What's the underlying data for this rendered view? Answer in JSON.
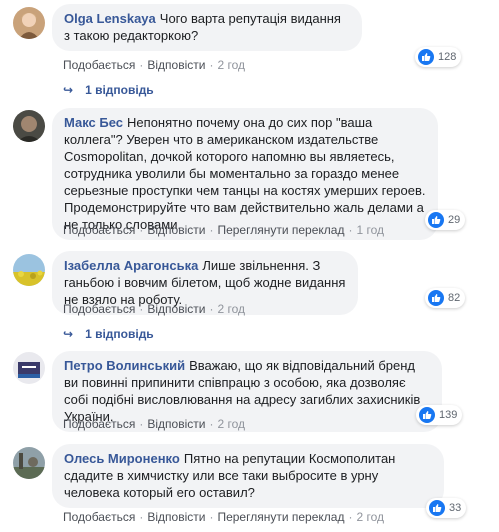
{
  "comments": [
    {
      "author": "Olga Lenskaya",
      "text": "Чого варта репутація видання з такою редакторкою?",
      "likes": "128",
      "actions": {
        "like": "Подобається",
        "reply": "Відповісти",
        "time": "2 год"
      },
      "replies": "1 відповідь"
    },
    {
      "author": "Макс Бес",
      "text": "Непонятно почему она до сих пор \"ваша коллега\"? Уверен что в американском издательстве Cosmopolitan, дочкой которого напомню вы являетесь, сотрудника уволили бы моментально за гораздо менее серьезные проступки чем танцы на костях умерших героев. Продемонстрируйте что вам действительно жаль делами а не только словами.",
      "likes": "29",
      "actions": {
        "like": "Подобається",
        "reply": "Відповісти",
        "translate": "Переглянути переклад",
        "time": "1 год"
      }
    },
    {
      "author": "Ізабелла Арагонська",
      "text": "Лише звільнення. З ганьбою і вовчим білетом, щоб жодне видання не взяло на роботу.",
      "likes": "82",
      "actions": {
        "like": "Подобається",
        "reply": "Відповісти",
        "time": "2 год"
      },
      "replies": "1 відповідь"
    },
    {
      "author": "Петро Волинський",
      "text": "Вважаю, що як відповідальний бренд ви повинні припинити співпрацю з особою, яка дозволяє собі подібні висловлювання на адресу загиблих захисників України.",
      "likes": "139",
      "actions": {
        "like": "Подобається",
        "reply": "Відповісти",
        "time": "2 год"
      }
    },
    {
      "author": "Олесь Мироненко",
      "text": "Пятно на репутации Космополитан сдадите в химчистку или все таки выбросите в урну человека который его оставил?",
      "likes": "33",
      "actions": {
        "like": "Подобається",
        "reply": "Відповісти",
        "translate": "Переглянути переклад",
        "time": "2 год"
      }
    }
  ],
  "colors": {
    "author": "#385898",
    "bubble": "#f2f3f5",
    "like": "#1877f2",
    "meta": "#606770"
  }
}
